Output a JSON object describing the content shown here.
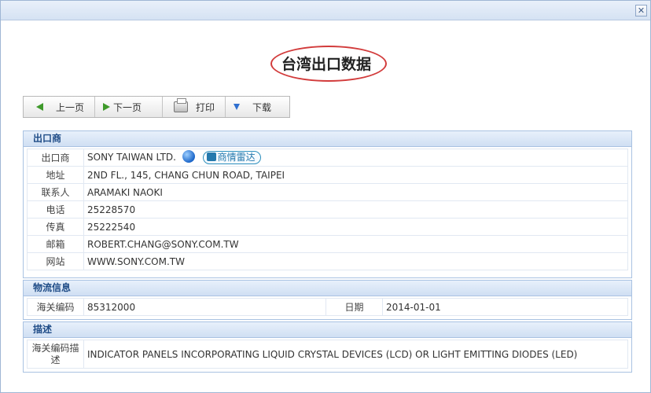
{
  "dialog": {
    "close_glyph": "✕"
  },
  "header": {
    "title": "台湾出口数据"
  },
  "toolbar": {
    "prev_label": "上一页",
    "next_label": "下一页",
    "print_label": "打印",
    "download_label": "下载"
  },
  "exporter": {
    "section_title": "出口商",
    "rows": [
      {
        "label": "出口商",
        "value": "SONY TAIWAN LTD."
      },
      {
        "label": "地址",
        "value": "2ND FL., 145, CHANG CHUN ROAD, TAIPEI"
      },
      {
        "label": "联系人",
        "value": "ARAMAKI NAOKI"
      },
      {
        "label": "电话",
        "value": "25228570"
      },
      {
        "label": "传真",
        "value": "25222540"
      },
      {
        "label": "邮箱",
        "value": "ROBERT.CHANG@SONY.COM.TW"
      },
      {
        "label": "网站",
        "value": "WWW.SONY.COM.TW"
      }
    ],
    "radar_label": "商情雷达"
  },
  "logistics": {
    "section_title": "物流信息",
    "hs_label": "海关编码",
    "hs_value": "85312000",
    "date_label": "日期",
    "date_value": "2014-01-01"
  },
  "description": {
    "section_title": "描述",
    "label": "海关编码描述",
    "value": "INDICATOR PANELS INCORPORATING LIQUID CRYSTAL DEVICES (LCD) OR LIGHT EMITTING DIODES (LED)"
  },
  "colors": {
    "accent": "#1f4c87",
    "highlight_oval": "#d23b3b",
    "border": "#a9c2e2"
  },
  "icons": {
    "prev": "arrow-left-icon",
    "next": "arrow-right-icon",
    "print": "printer-icon",
    "download": "arrow-down-icon",
    "website": "globe-icon",
    "radar": "radar-icon"
  }
}
